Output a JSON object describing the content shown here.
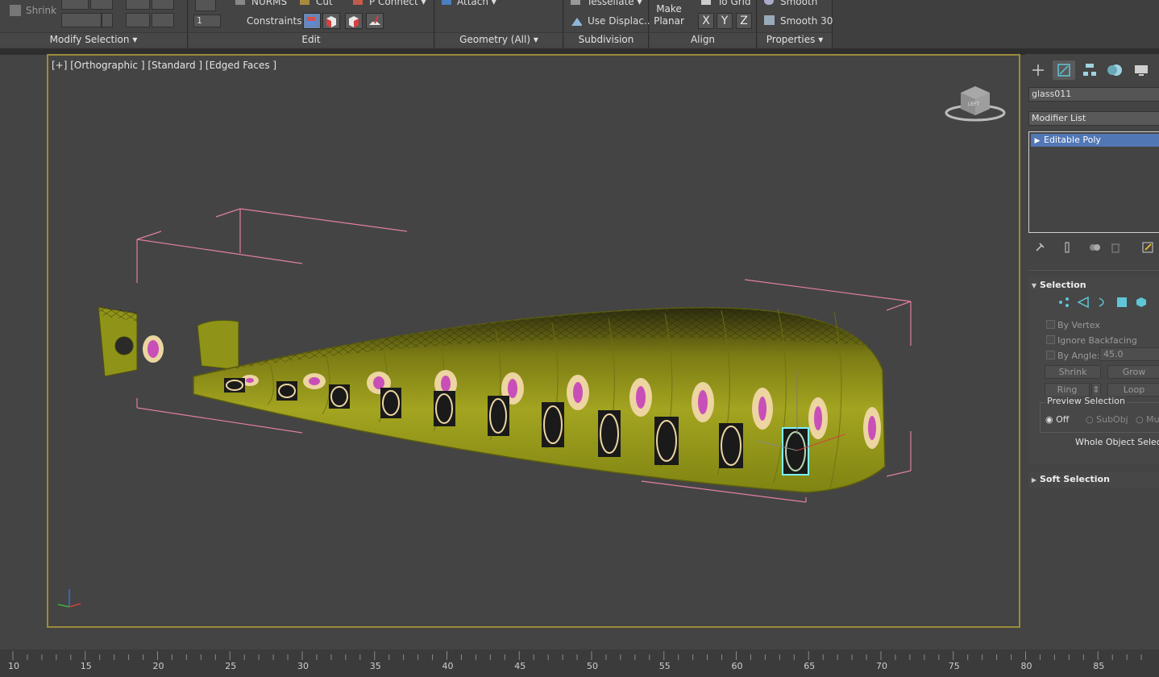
{
  "ribbon": {
    "modify_selection": {
      "shrink_label": "Shrink",
      "title": "Modify Selection"
    },
    "edit": {
      "nurms_label": "NURMS",
      "cut_label": "Cut",
      "pconnect_label": "P Connect",
      "spinner_value": "1",
      "constraints_label": "Constraints:",
      "title": "Edit"
    },
    "geometry": {
      "attach_label": "Attach",
      "title": "Geometry (All)"
    },
    "subdivision": {
      "tessellate_label": "Tessellate",
      "use_displace_label": "Use Displac...",
      "title": "Subdivision"
    },
    "align": {
      "make_planar_line1": "Make",
      "make_planar_line2": "Planar",
      "to_grid_label": "To Grid",
      "x_label": "X",
      "y_label": "Y",
      "z_label": "Z",
      "title": "Align"
    },
    "properties": {
      "smooth_label": "Smooth",
      "smooth30_label": "Smooth 30",
      "title": "Properties"
    }
  },
  "viewport": {
    "label": "[+] [Orthographic ] [Standard ] [Edged Faces ]",
    "viewcube_face": "LEFT",
    "accent_color": "#9c8b3a"
  },
  "command_panel": {
    "tabs": [
      "create-icon",
      "modify-icon",
      "hierarchy-icon",
      "motion-icon",
      "display-icon"
    ],
    "object_name": "glass011",
    "modifier_list_label": "Modifier List",
    "stack_item": "Editable Poly",
    "selection": {
      "title": "Selection",
      "by_vertex": "By Vertex",
      "ignore_backfacing": "Ignore Backfacing",
      "by_angle": "By Angle:",
      "by_angle_value": "45.0",
      "shrink": "Shrink",
      "grow": "Grow",
      "ring": "Ring",
      "loop": "Loop",
      "preview_selection": "Preview Selection",
      "off": "Off",
      "subobj": "SubObj",
      "multi": "Mu",
      "whole_object": "Whole Object Selecte"
    },
    "soft_selection": {
      "title": "Soft Selection"
    }
  },
  "timeline": {
    "ticks": [
      "10",
      "15",
      "20",
      "25",
      "30",
      "35",
      "40",
      "45",
      "50",
      "55",
      "60",
      "65",
      "70",
      "75",
      "80",
      "85"
    ]
  }
}
